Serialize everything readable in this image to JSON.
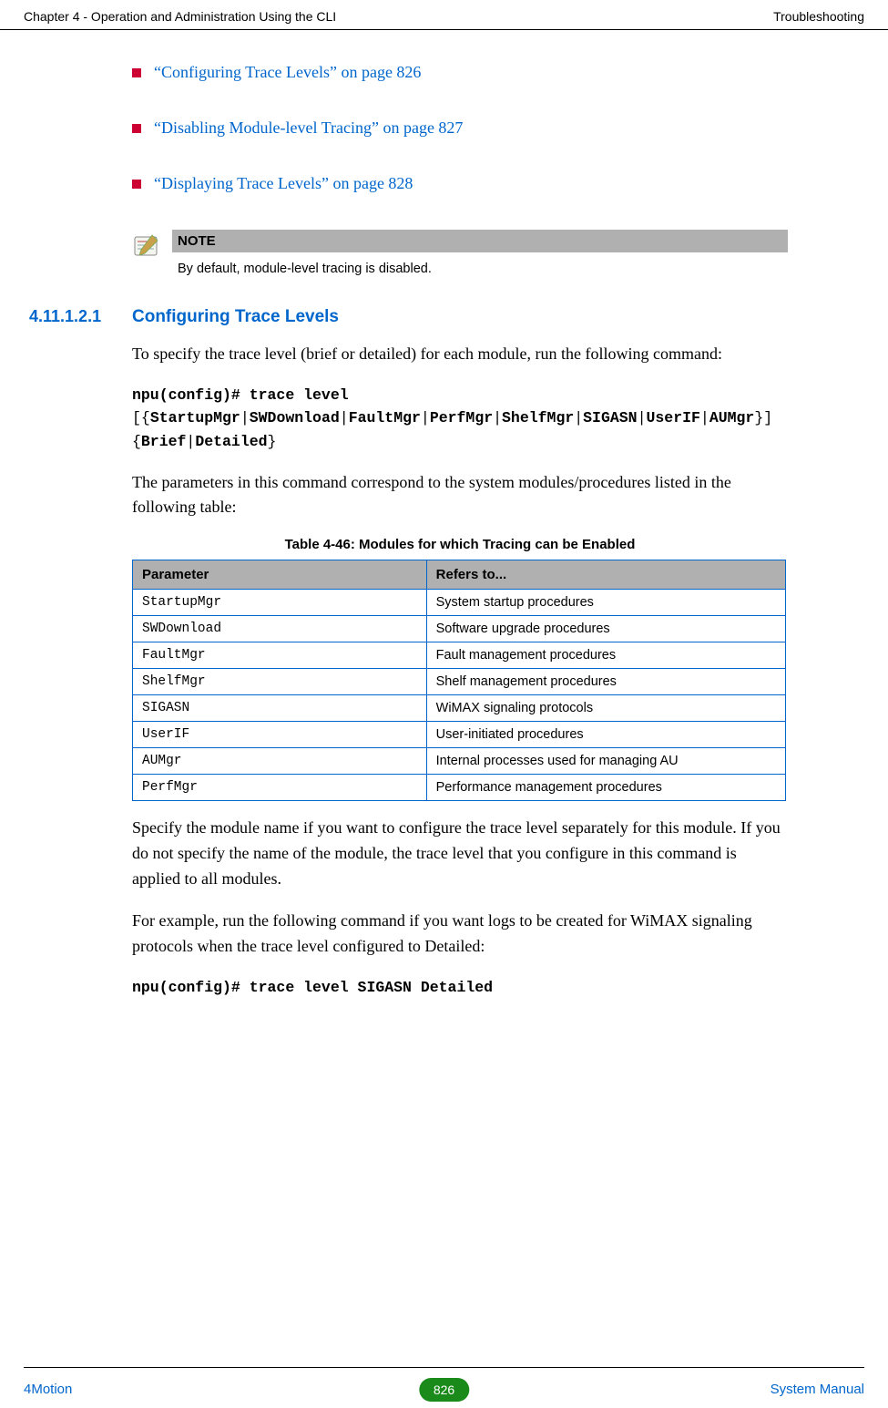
{
  "header": {
    "left": "Chapter 4 - Operation and Administration Using the CLI",
    "right": "Troubleshooting"
  },
  "links": [
    "“Configuring Trace Levels” on page 826",
    "“Disabling Module-level Tracing” on page 827",
    "“Displaying Trace Levels” on page 828"
  ],
  "note": {
    "label": "NOTE",
    "body": "By default, module-level tracing is disabled."
  },
  "section": {
    "number": "4.11.1.2.1",
    "title": "Configuring Trace Levels"
  },
  "para1": "To specify the trace level (brief or detailed) for each module, run the following command:",
  "code1": {
    "line1_bold": "npu(config)# trace level",
    "line2_pre": "[{",
    "line2_tokens": [
      "StartupMgr",
      "SWDownload",
      "FaultMgr",
      "PerfMgr",
      "ShelfMgr",
      "SIGASN",
      "UserIF",
      "AUMgr"
    ],
    "line2_post": "}] {",
    "line2_opts": [
      "Brief",
      "Detailed"
    ],
    "line2_end": "}"
  },
  "para2": "The parameters in this command correspond to the system modules/procedures listed in the following table:",
  "table": {
    "caption": "Table 4-46: Modules for which Tracing can be Enabled",
    "headers": [
      "Parameter",
      "Refers to..."
    ],
    "rows": [
      [
        "StartupMgr",
        "System startup procedures"
      ],
      [
        "SWDownload",
        "Software upgrade procedures"
      ],
      [
        "FaultMgr",
        "Fault management procedures"
      ],
      [
        "ShelfMgr",
        "Shelf management procedures"
      ],
      [
        "SIGASN",
        "WiMAX signaling protocols"
      ],
      [
        "UserIF",
        "User-initiated procedures"
      ],
      [
        "AUMgr",
        "Internal processes used for managing AU"
      ],
      [
        "PerfMgr",
        "Performance management procedures"
      ]
    ]
  },
  "para3": "Specify the module name if you want to configure the trace level separately for this module. If you do not specify the name of the module, the trace level that you configure in this command is applied to all modules.",
  "para4": "For example, run the following command if you want logs to be created for WiMAX signaling protocols when the trace level configured to Detailed:",
  "code2": "npu(config)# trace level SIGASN Detailed",
  "footer": {
    "left": "4Motion",
    "page": "826",
    "right": "System Manual"
  }
}
